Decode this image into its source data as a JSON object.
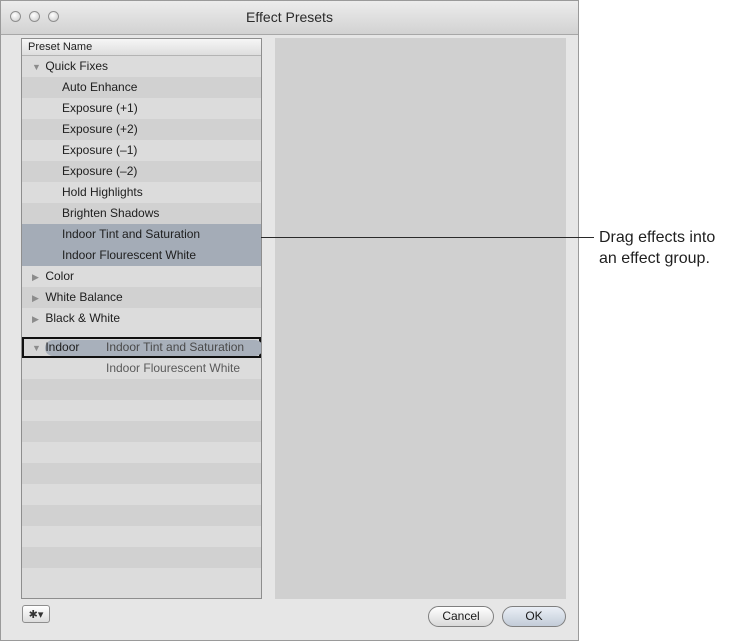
{
  "window": {
    "title": "Effect Presets"
  },
  "list": {
    "header": "Preset Name",
    "rows": [
      {
        "label": "Quick Fixes",
        "triangle": "▼"
      },
      {
        "label": "Auto Enhance"
      },
      {
        "label": "Exposure (+1)"
      },
      {
        "label": "Exposure (+2)"
      },
      {
        "label": "Exposure (–1)"
      },
      {
        "label": "Exposure (–2)"
      },
      {
        "label": "Hold Highlights"
      },
      {
        "label": "Brighten Shadows"
      },
      {
        "label": "Indoor Tint and Saturation"
      },
      {
        "label": "Indoor Flourescent White"
      },
      {
        "label": "Color",
        "triangle": "▶"
      },
      {
        "label": "White Balance",
        "triangle": "▶"
      },
      {
        "label": "Black & White",
        "triangle": "▶"
      },
      {
        "label": "Indoor",
        "triangle": "▼"
      },
      {
        "drag_label_1": "Indoor Tint and Saturation",
        "drag_label_2": "Indoor Flourescent White"
      }
    ]
  },
  "buttons": {
    "gear": "✱▾",
    "cancel": "Cancel",
    "ok": "OK"
  },
  "callout": {
    "line1": "Drag effects into",
    "line2": "an effect group."
  }
}
